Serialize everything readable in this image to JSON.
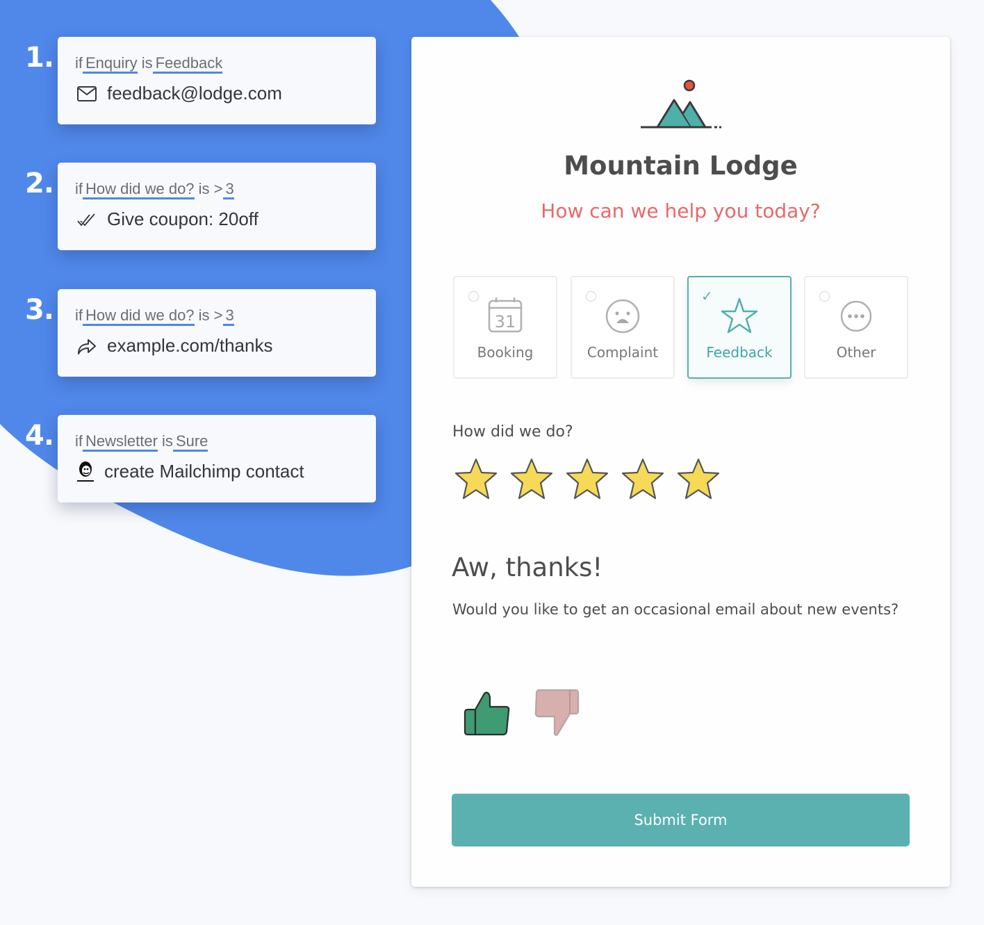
{
  "colors": {
    "blob": "#5088ea",
    "accent_teal": "#5ab1b0",
    "subtitle_red": "#e9686a",
    "underline_blue": "#4f86e8",
    "star_fill": "#f6d957",
    "thumb_up": "#3f9b72",
    "thumb_down": "#d7b0ad"
  },
  "rules": [
    {
      "number": "1.",
      "if_word": "if",
      "field": "Enquiry",
      "operator": "is",
      "value": "Feedback",
      "action_icon": "envelope-icon",
      "action_text": "feedback@lodge.com"
    },
    {
      "number": "2.",
      "if_word": "if",
      "field": "How did we do?",
      "operator": "is >",
      "value": "3",
      "action_icon": "double-check-icon",
      "action_text": "Give coupon: 20off"
    },
    {
      "number": "3.",
      "if_word": "if",
      "field": "How did we do?",
      "operator": "is >",
      "value": "3",
      "action_icon": "share-arrow-icon",
      "action_text": "example.com/thanks"
    },
    {
      "number": "4.",
      "if_word": "if",
      "field": "Newsletter",
      "operator": "is",
      "value": "Sure",
      "action_icon": "mailchimp-logo-icon",
      "action_text": "create Mailchimp contact"
    }
  ],
  "form": {
    "logo_icon": "mountain-logo-icon",
    "title": "Mountain Lodge",
    "subtitle": "How can we help you today?",
    "enquiry_options": [
      {
        "label": "Booking",
        "icon": "calendar-icon",
        "calendar_day": "31",
        "selected": false
      },
      {
        "label": "Complaint",
        "icon": "sad-face-icon",
        "selected": false
      },
      {
        "label": "Feedback",
        "icon": "star-outline-icon",
        "selected": true
      },
      {
        "label": "Other",
        "icon": "ellipsis-circle-icon",
        "selected": false
      }
    ],
    "rating_label": "How did we do?",
    "rating": {
      "value": 5,
      "max": 5
    },
    "thanks_heading": "Aw, thanks!",
    "newsletter_question": "Would you like to get an occasional email about new events?",
    "newsletter_options": [
      "thumbs-up",
      "thumbs-down"
    ],
    "newsletter_selected": "thumbs-up",
    "submit_label": "Submit Form"
  }
}
